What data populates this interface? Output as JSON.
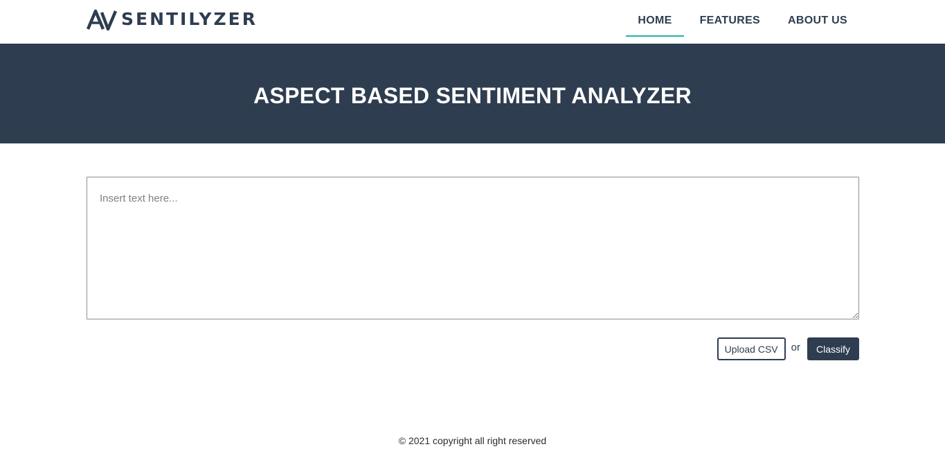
{
  "brand": {
    "name": "SENTILYZER",
    "logo_icon": "triangle-monogram-logo",
    "color": "#2e3d50"
  },
  "nav": {
    "items": [
      {
        "label": "HOME",
        "active": true
      },
      {
        "label": "FEATURES",
        "active": false
      },
      {
        "label": "ABOUT US",
        "active": false
      }
    ],
    "active_color": "#25b39e"
  },
  "hero": {
    "title": "ASPECT BASED SENTIMENT ANALYZER",
    "background": "#2e3d50"
  },
  "input": {
    "placeholder": "Insert text here...",
    "value": ""
  },
  "actions": {
    "upload_label": "Upload CSV",
    "separator": "or",
    "classify_label": "Classify"
  },
  "footer": {
    "text": "© 2021 copyright all right reserved"
  }
}
